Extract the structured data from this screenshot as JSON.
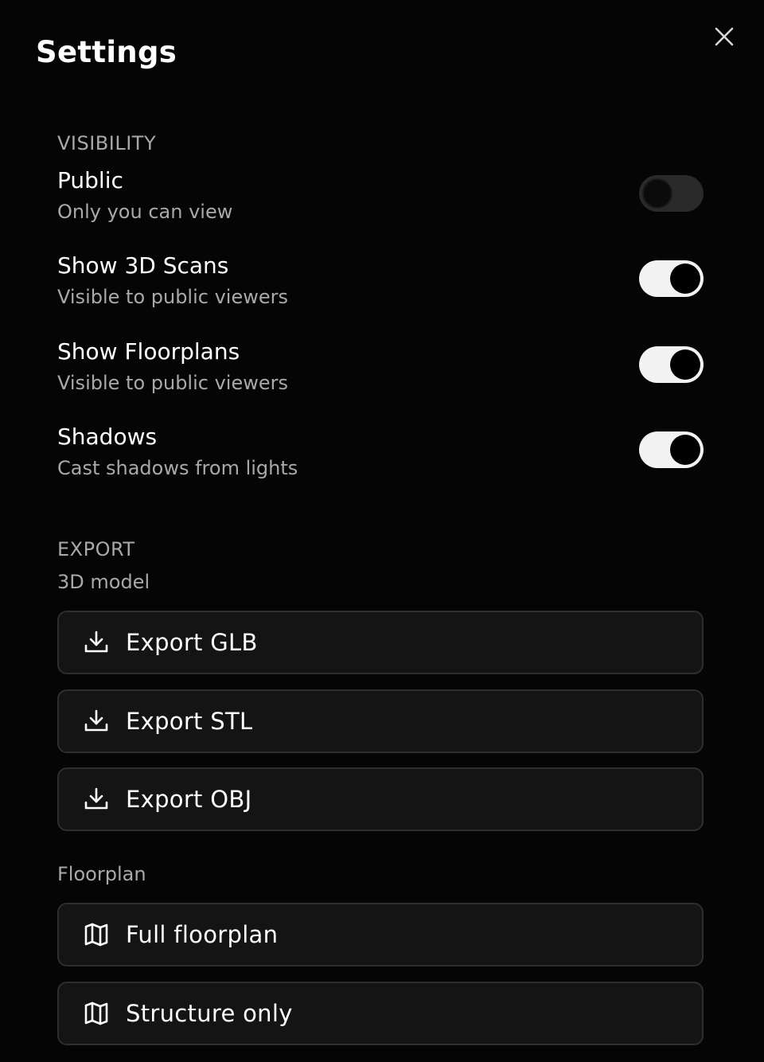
{
  "header": {
    "title": "Settings"
  },
  "visibility": {
    "section_label": "VISIBILITY",
    "items": [
      {
        "title": "Public",
        "description": "Only you can view",
        "enabled": false
      },
      {
        "title": "Show 3D Scans",
        "description": "Visible to public viewers",
        "enabled": true
      },
      {
        "title": "Show Floorplans",
        "description": "Visible to public viewers",
        "enabled": true
      },
      {
        "title": "Shadows",
        "description": "Cast shadows from lights",
        "enabled": true
      }
    ]
  },
  "export": {
    "section_label": "EXPORT",
    "model_label": "3D model",
    "model_buttons": [
      {
        "label": "Export GLB",
        "icon": "download-icon"
      },
      {
        "label": "Export STL",
        "icon": "download-icon"
      },
      {
        "label": "Export OBJ",
        "icon": "download-icon"
      }
    ],
    "floorplan_label": "Floorplan",
    "floorplan_buttons": [
      {
        "label": "Full floorplan",
        "icon": "map-icon"
      },
      {
        "label": "Structure only",
        "icon": "map-icon"
      }
    ]
  },
  "colors": {
    "background": "#050505",
    "button_bg": "#141414",
    "toggle_on": "#f2f2f2",
    "toggle_off": "#2a2a2a",
    "muted_text": "#a9a9a9"
  }
}
